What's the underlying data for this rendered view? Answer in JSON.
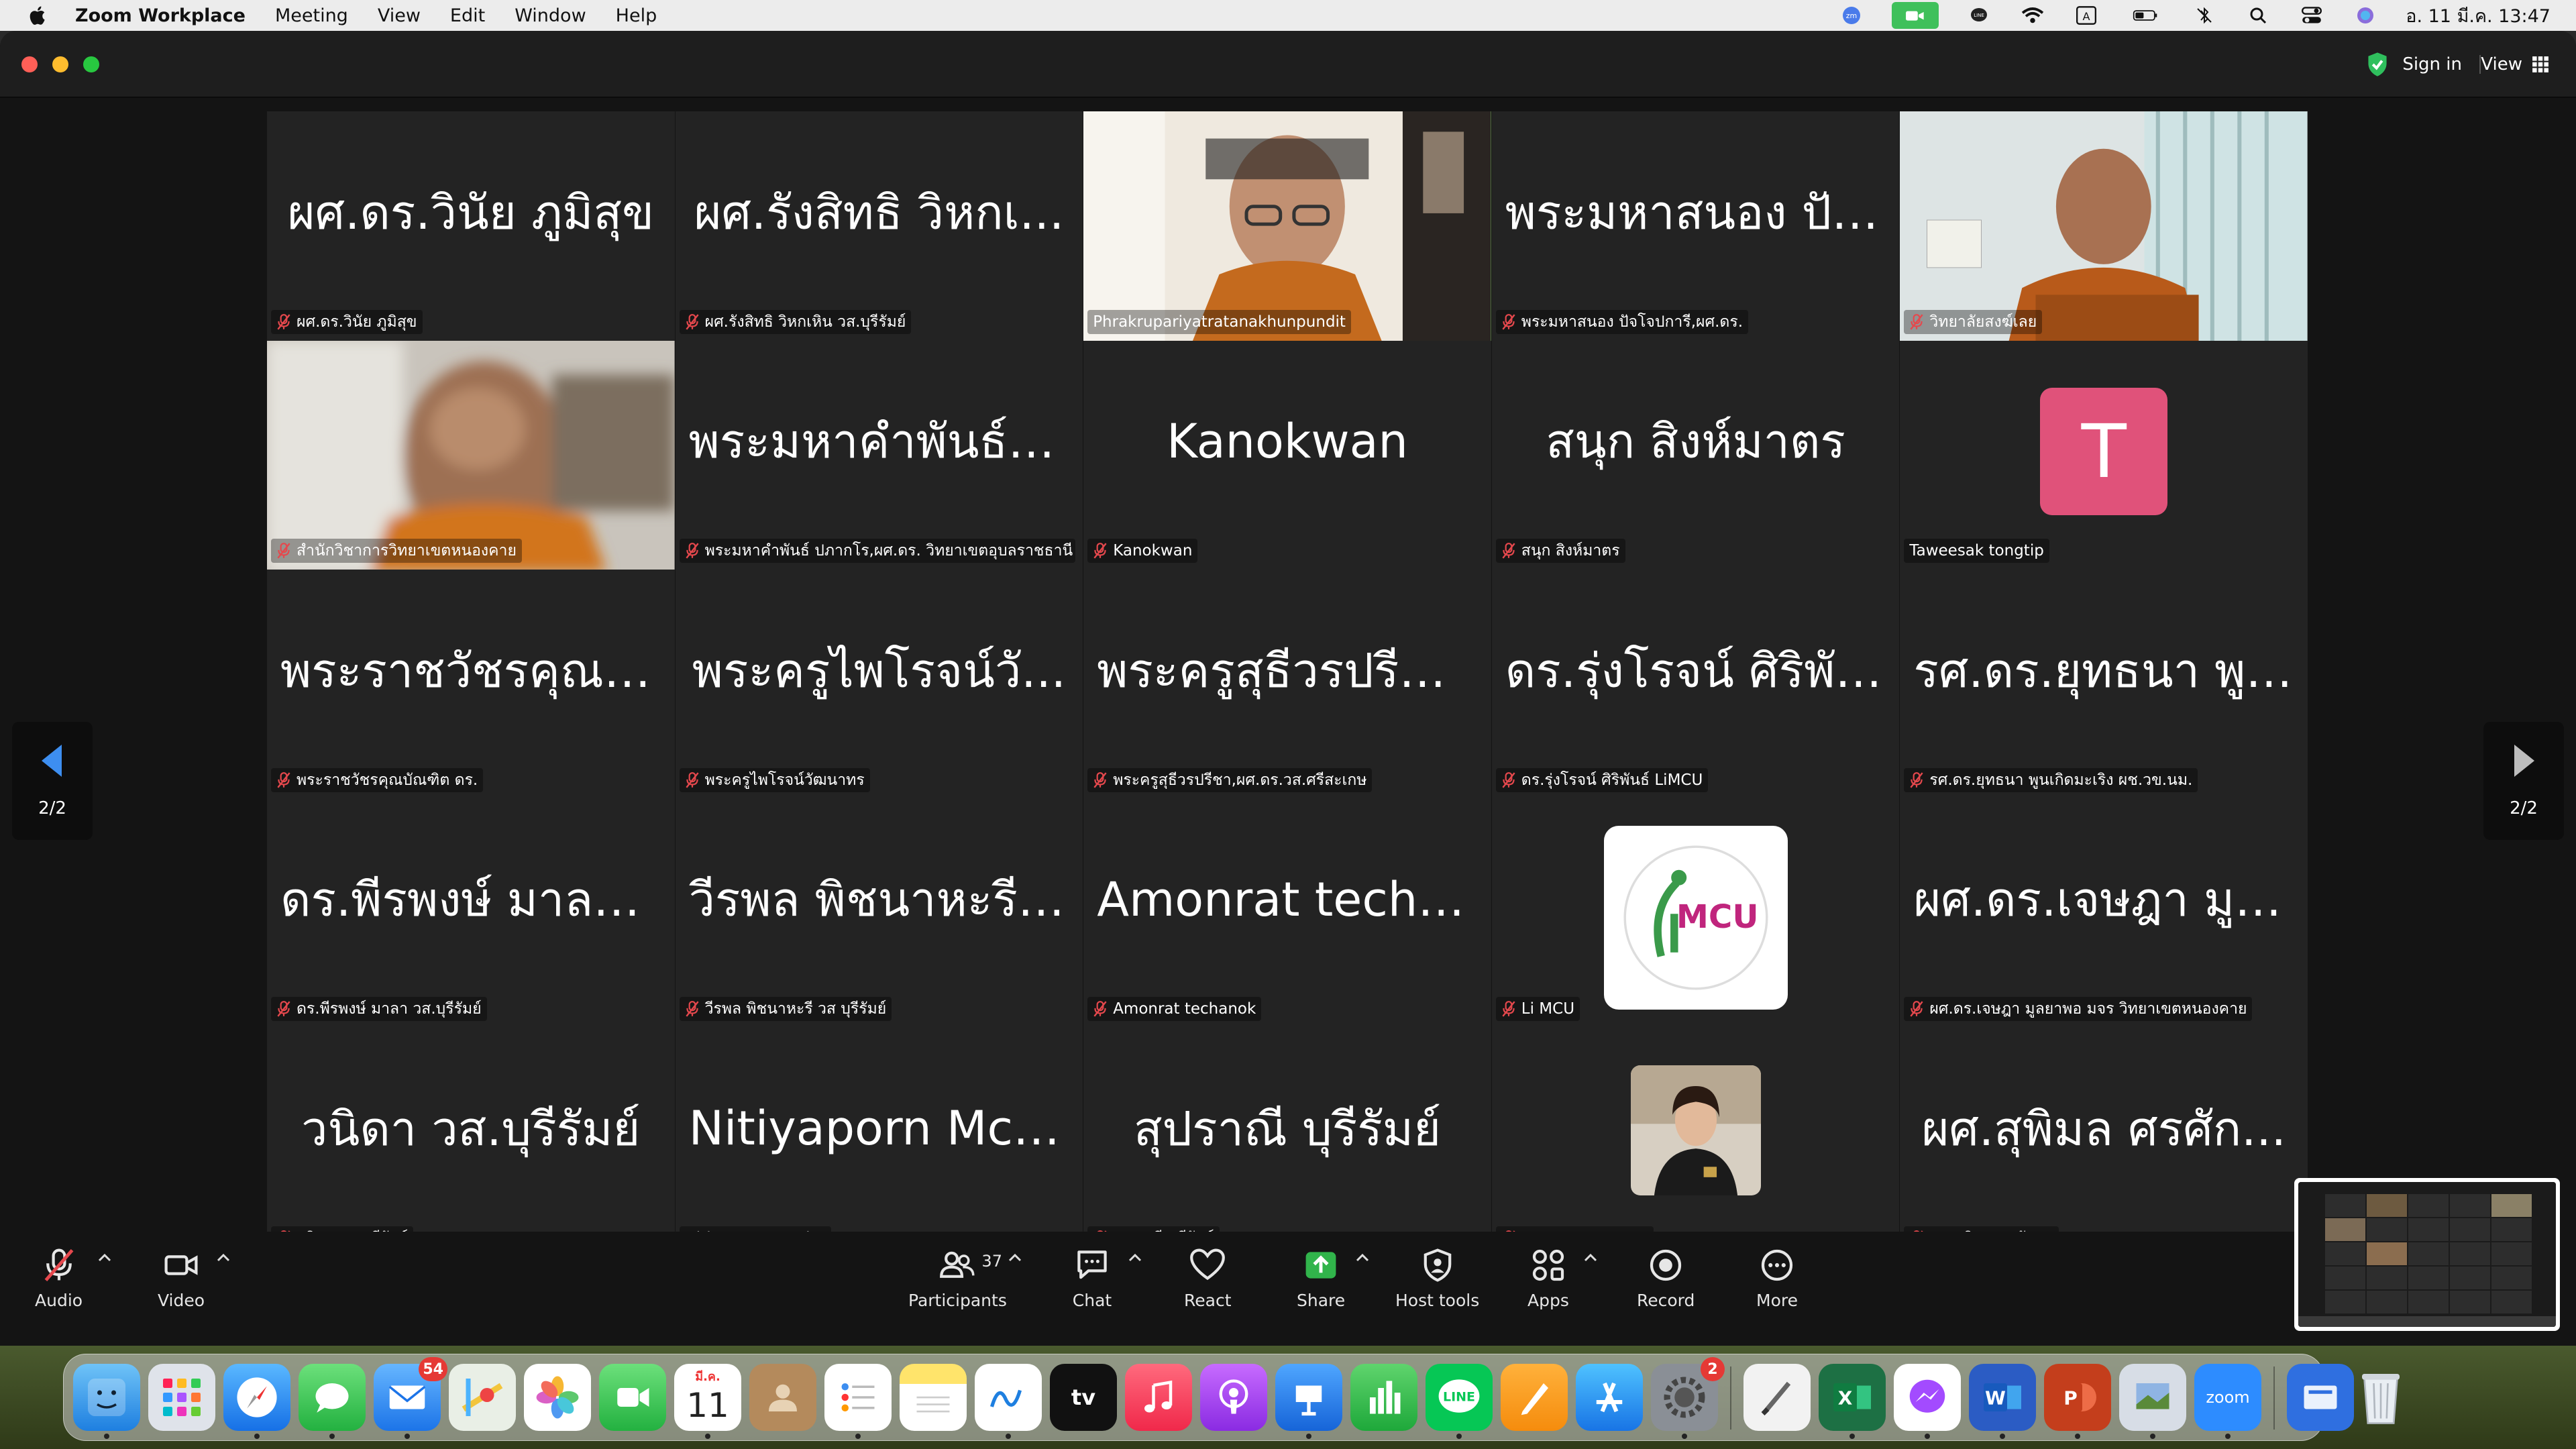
{
  "menubar": {
    "app_name": "Zoom Workplace",
    "items": [
      "Meeting",
      "View",
      "Edit",
      "Window",
      "Help"
    ],
    "datetime": "อ. 11 มี.ค.  13:47"
  },
  "titlebar": {
    "sign_in": "Sign in",
    "view": "View"
  },
  "pager": {
    "left": "2/2",
    "right": "2/2"
  },
  "tiles": [
    {
      "big": "ผศ.ดร.วินัย ภูมิสุข",
      "label": "ผศ.ดร.วินัย ภูมิสุข",
      "muted": true
    },
    {
      "big": "ผศ.รังสิทธิ  วิหกเ...",
      "label": "ผศ.รังสิทธิ  วิหกเหิน วส.บุรีรัมย์",
      "muted": true
    },
    {
      "big": "",
      "label": "Phrakrupariyatratanakhunpundit",
      "muted": false,
      "video": "monk-glasses",
      "active": true
    },
    {
      "big": "พระมหาสนอง ปัจ...",
      "label": "พระมหาสนอง ปัจโจปการี,ผศ.ดร.",
      "muted": true
    },
    {
      "big": "",
      "label": "วิทยาลัยสงฆ์เลย",
      "muted": true,
      "video": "monk-office"
    },
    {
      "big": "",
      "label": "สำนักวิชาการวิทยาเขตหนองคาย",
      "muted": true,
      "video": "monk-blur"
    },
    {
      "big": "พระมหาคำพันธ์ ป...",
      "label": "พระมหาคำพันธ์ ปภากโร,ผศ.ดร. วิทยาเขตอุบลราชธานี",
      "muted": true
    },
    {
      "big": "Kanokwan",
      "label": "Kanokwan",
      "muted": true
    },
    {
      "big": "สนุก สิงห์มาตร",
      "label": "สนุก สิงห์มาตร",
      "muted": true
    },
    {
      "big": "",
      "label": "Taweesak tongtip",
      "muted": false,
      "avatar_letter": "T"
    },
    {
      "big": "พระราชวัชรคุณบั...",
      "label": "พระราชวัชรคุณบัณฑิต ดร.",
      "muted": true
    },
    {
      "big": "พระครูไพโรจน์วั...",
      "label": "พระครูไพโรจน์วัฒนาทร",
      "muted": true
    },
    {
      "big": "พระครูสุธีวรปรีชา...",
      "label": "พระครูสุธีวรปรีชา,ผศ.ดร.วส.ศรีสะเกษ",
      "muted": true
    },
    {
      "big": "ดร.รุ่งโรจน์  ศิริพัน...",
      "label": "ดร.รุ่งโรจน์  ศิริพันธ์ LiMCU",
      "muted": true
    },
    {
      "big": "รศ.ดร.ยุทธนา พูน...",
      "label": "รศ.ดร.ยุทธนา พูนเกิดมะเริง ผช.วข.นม.",
      "muted": true
    },
    {
      "big": "ดร.พีรพงษ์  มาลา...",
      "label": "ดร.พีรพงษ์  มาลา วส.บุรีรัมย์",
      "muted": true
    },
    {
      "big": "วีรพล พิชนาหะรี ว...",
      "label": "วีรพล พิชนาหะรี วส บุรีรัมย์",
      "muted": true
    },
    {
      "big": "Amonrat techanok",
      "label": "Amonrat techanok",
      "muted": true
    },
    {
      "big": "",
      "label": "Li MCU",
      "muted": true,
      "logo_text": "MCU"
    },
    {
      "big": "ผศ.ดร.เจษฎา มูล...",
      "label": "ผศ.ดร.เจษฎา มูลยาพอ  มจร วิทยาเขตหนองคาย",
      "muted": true
    },
    {
      "big": "วนิดา วส.บุรีรัมย์",
      "label": "วนิดา วส.บุรีรัมย์",
      "muted": true
    },
    {
      "big": "Nitiyaporn Mcu br.",
      "label": "Nitiyaporn Mcu br.",
      "muted": false
    },
    {
      "big": "สุปราณี บุรีรัมย์",
      "label": "สุปราณี บุรีรัมย์",
      "muted": true
    },
    {
      "big": "",
      "label": "PIKUL MEEMANA",
      "muted": true,
      "photo": true
    },
    {
      "big": "ผศ.สุพิมล  ศรศัก...",
      "label": "ผศ.สุพิมล  ศรศักดา",
      "muted": true
    }
  ],
  "toolbar": {
    "audio": "Audio",
    "video": "Video",
    "participants": "Participants",
    "participants_count": "37",
    "chat": "Chat",
    "react": "React",
    "share": "Share",
    "host_tools": "Host tools",
    "apps": "Apps",
    "record": "Record",
    "more": "More"
  },
  "dock": {
    "mail_badge": "54",
    "settings_badge": "2",
    "calendar_month": "มี.ค.",
    "calendar_day": "11",
    "zoom_label": "zoom"
  },
  "colors": {
    "active_border": "#7cd75f",
    "avatar_bg": "#e0527a",
    "mute_red": "#e5484d",
    "share_green": "#31b44b"
  }
}
